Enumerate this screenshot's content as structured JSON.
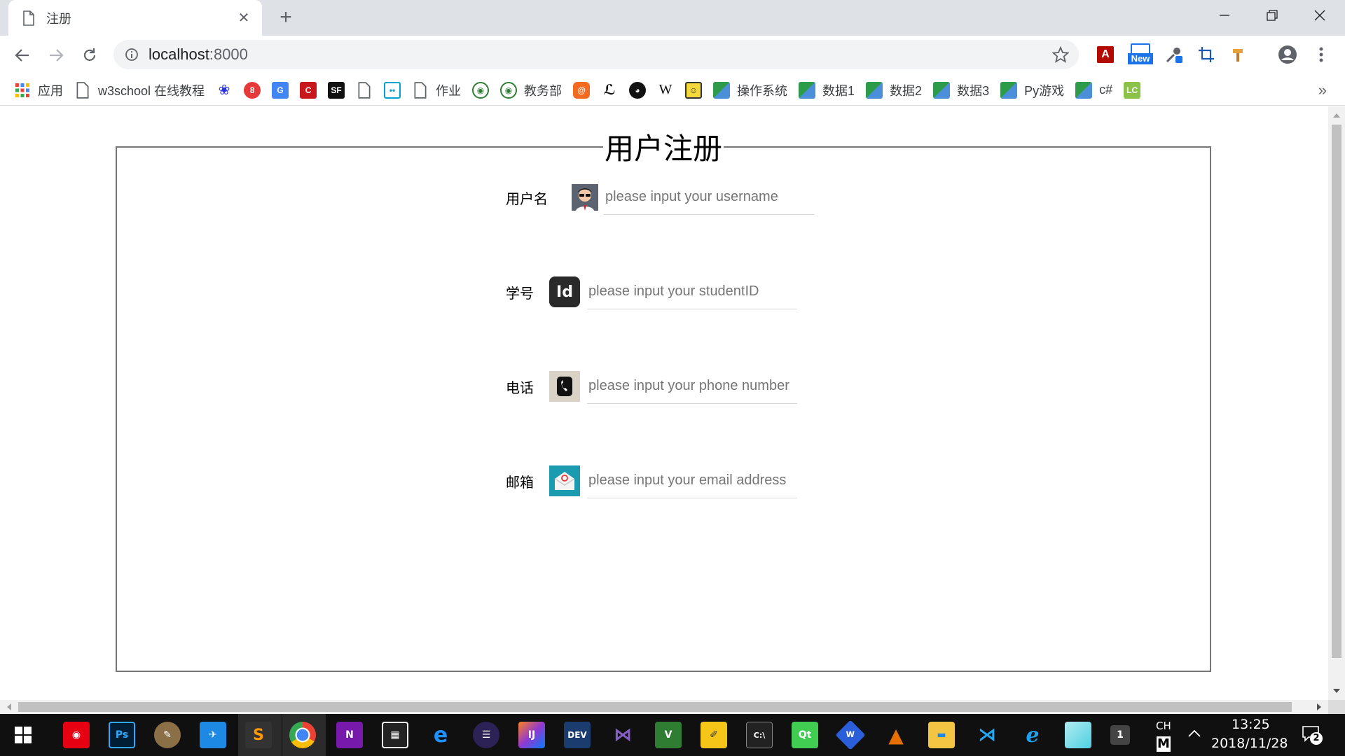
{
  "browser": {
    "tab_title": "注册",
    "url_host": "localhost",
    "url_port": ":8000",
    "new_badge": "New"
  },
  "bookmarks": {
    "apps": "应用",
    "w3school": "w3school 在线教程",
    "homework": "作业",
    "academic": "教务部",
    "wiki": "W",
    "os": "操作系统",
    "data1": "数据1",
    "data2": "数据2",
    "data3": "数据3",
    "pygame": "Py游戏",
    "csharp": "c#",
    "more": "»"
  },
  "form": {
    "legend": "用户注册",
    "fields": [
      {
        "label": "用户名",
        "placeholder": "please input your username",
        "icon": "user-avatar-icon"
      },
      {
        "label": "学号",
        "placeholder": "please input your studentID",
        "icon": "id-icon"
      },
      {
        "label": "电话",
        "placeholder": "please input your phone number",
        "icon": "phone-icon"
      },
      {
        "label": "邮箱",
        "placeholder": "please input your email address",
        "icon": "mail-icon"
      }
    ]
  },
  "taskbar": {
    "lang": "CH",
    "ime": "M",
    "time": "13:25",
    "date": "2018/11/28",
    "notifications": "2",
    "badge_1": "1"
  },
  "colors": {
    "tabstrip": "#dee1e6",
    "taskbar": "#101010",
    "fieldset_border": "#767676"
  }
}
